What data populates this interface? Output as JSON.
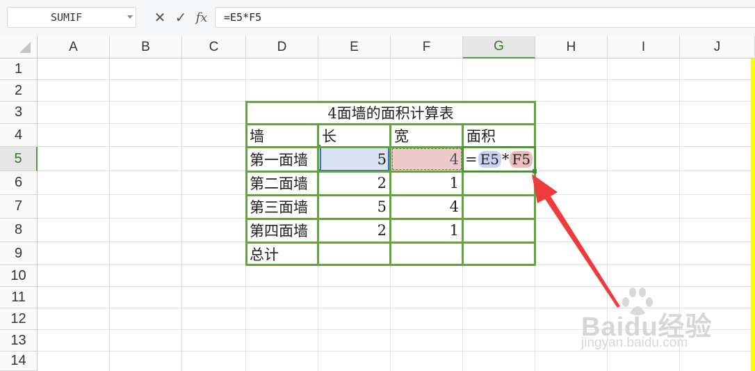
{
  "formula_bar": {
    "name_box": "SUMIF",
    "cancel_icon": "✕",
    "enter_icon": "✓",
    "fx_icon": "fx",
    "formula": "=E5*F5"
  },
  "columns": [
    "A",
    "B",
    "C",
    "D",
    "E",
    "F",
    "G",
    "H",
    "I",
    "J"
  ],
  "active_column": "G",
  "rows": [
    "1",
    "2",
    "3",
    "4",
    "5",
    "6",
    "7",
    "8",
    "9",
    "10",
    "11",
    "12",
    "13",
    "14"
  ],
  "active_row": "5",
  "table": {
    "title": "4面墙的面积计算表",
    "headers": [
      "墙",
      "长",
      "宽",
      "面积"
    ],
    "rows": [
      {
        "name": "第一面墙",
        "length": "5",
        "width": "4"
      },
      {
        "name": "第二面墙",
        "length": "2",
        "width": "1"
      },
      {
        "name": "第三面墙",
        "length": "5",
        "width": "4"
      },
      {
        "name": "第四面墙",
        "length": "2",
        "width": "1"
      },
      {
        "name": "总计",
        "length": "",
        "width": ""
      }
    ],
    "editing_cell": {
      "prefix": "=",
      "ref1": "E5",
      "operator": "*",
      "ref2": "F5"
    }
  },
  "colors": {
    "table_border": "#62a53e",
    "ref1_highlight": "#dbe2f4",
    "ref2_highlight": "#eecaca",
    "arrow": "#ee3b3b",
    "active_header": "#4f9a3a"
  },
  "watermark": {
    "brand": "Baidu经验",
    "url": "jingyan.baidu.com"
  }
}
